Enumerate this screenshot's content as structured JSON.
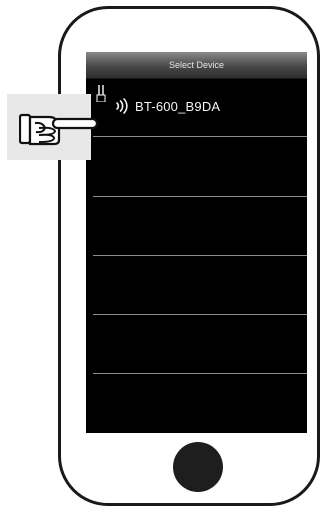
{
  "screen": {
    "title": "Select Device"
  },
  "devices": [
    {
      "name": "BT-600_B9DA",
      "icon": "signal-waves-icon"
    }
  ],
  "colors": {
    "screen_bg": "#000000",
    "title_bar": "#484848",
    "divider": "#8c8c8c",
    "phone_outline": "#1a1a1a"
  }
}
